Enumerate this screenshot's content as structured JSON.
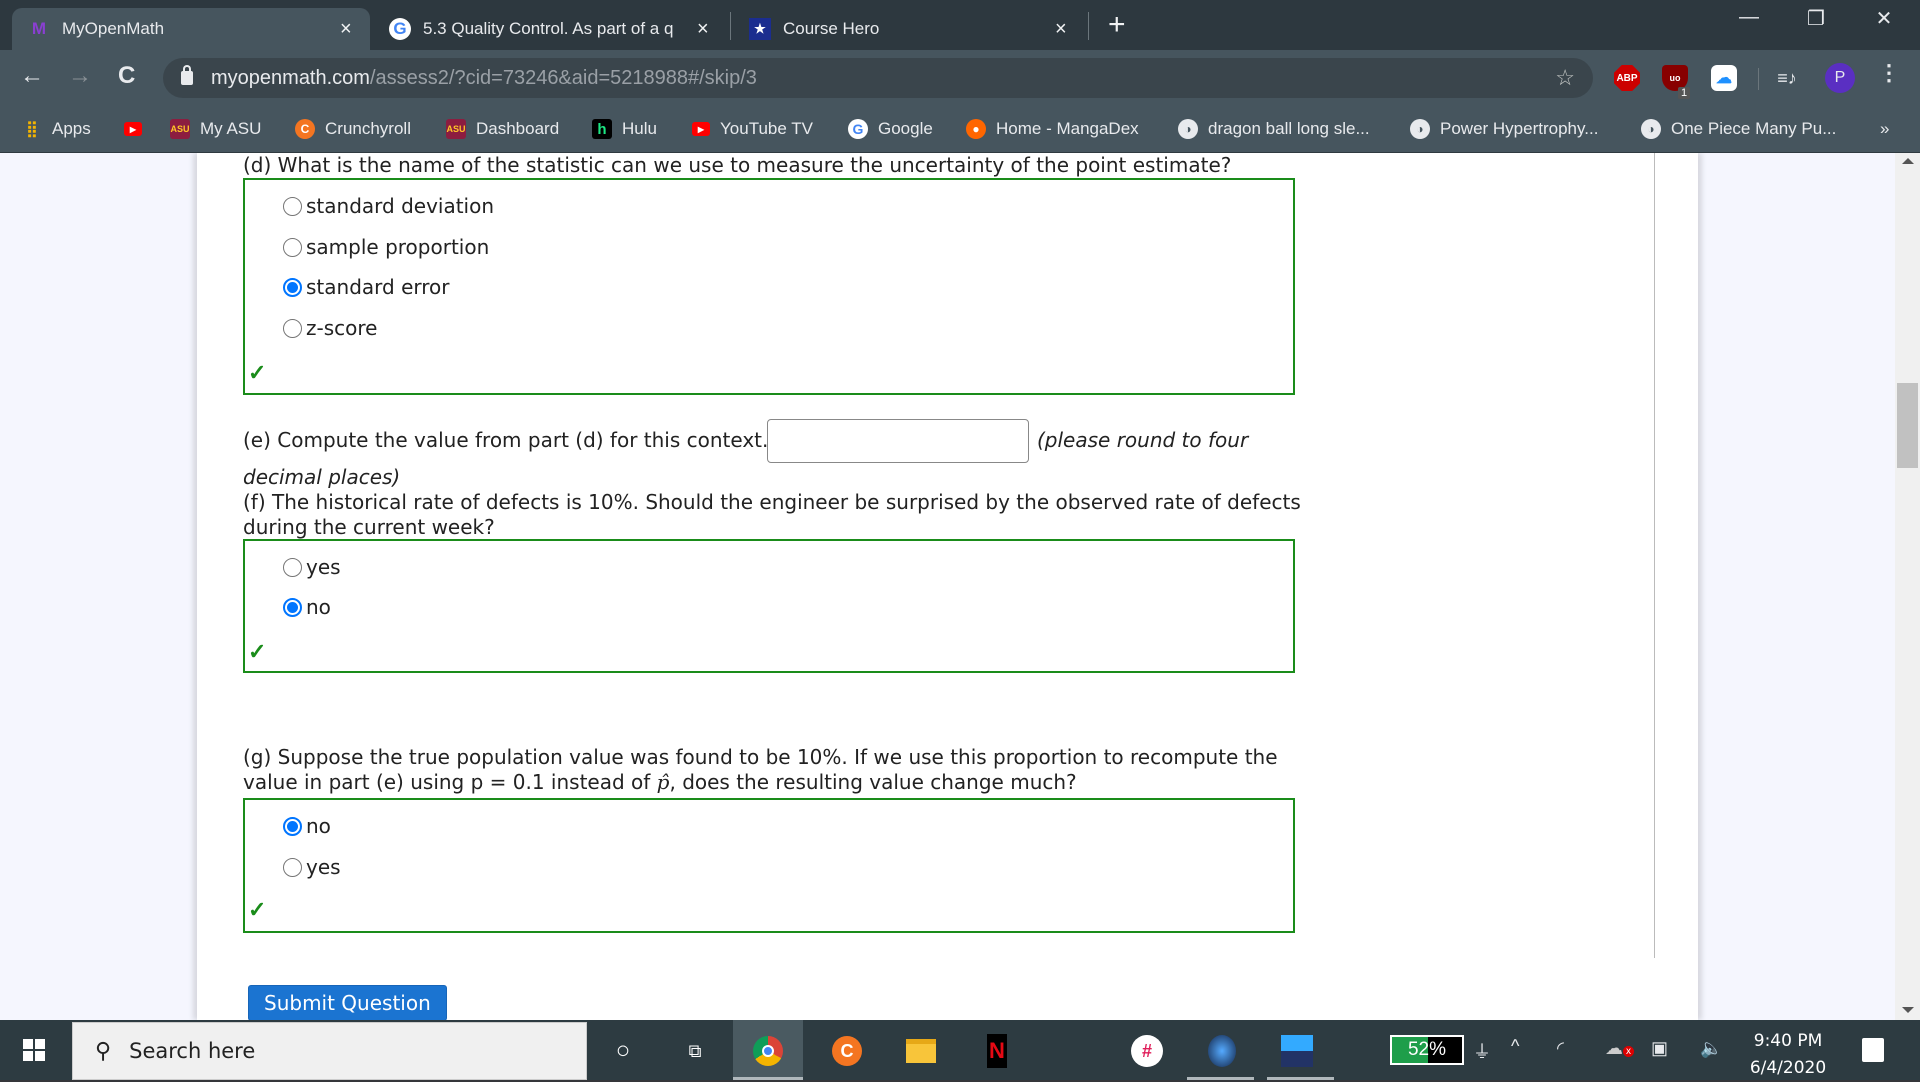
{
  "browser": {
    "tabs": [
      {
        "title": "MyOpenMath",
        "icon": "myopenmath-m-icon",
        "active": true
      },
      {
        "title": "5.3 Quality Control. As part of a q",
        "icon": "google-g-icon",
        "active": false
      },
      {
        "title": "Course Hero",
        "icon": "coursehero-star-icon",
        "active": false
      }
    ],
    "new_tab_label": "+",
    "window_controls": {
      "minimize": "—",
      "restore": "❐",
      "close": "✕"
    },
    "nav": {
      "back": "←",
      "forward": "→",
      "reload": "C"
    },
    "address": {
      "host": "myopenmath.com",
      "path": "/assess2/?cid=73246&aid=5218988#/skip/3"
    },
    "extensions": {
      "abp": "ABP",
      "ublock": "uo",
      "ublock_badge": "1",
      "cloud": "☁",
      "media": "≡♪"
    },
    "profile_initial": "P",
    "bookmarks": [
      {
        "label": "Apps",
        "icon": "apps-grid-icon"
      },
      {
        "label": "",
        "icon": "youtube-icon"
      },
      {
        "label": "My ASU",
        "icon": "asu-icon"
      },
      {
        "label": "Crunchyroll",
        "icon": "crunchyroll-icon"
      },
      {
        "label": "Dashboard",
        "icon": "asu-pitchfork-icon"
      },
      {
        "label": "Hulu",
        "icon": "hulu-icon"
      },
      {
        "label": "YouTube TV",
        "icon": "youtube-tv-icon"
      },
      {
        "label": "Google",
        "icon": "google-icon"
      },
      {
        "label": "Home - MangaDex",
        "icon": "mangadex-icon"
      },
      {
        "label": "dragon ball long sle...",
        "icon": "globe-icon"
      },
      {
        "label": "Power Hypertrophy...",
        "icon": "globe-icon"
      },
      {
        "label": "One Piece Many Pu...",
        "icon": "globe-icon"
      }
    ],
    "bookmarks_overflow": "»"
  },
  "question": {
    "d": {
      "prompt": "(d) What is the name of the statistic can we use to measure the uncertainty of the point estimate?",
      "options": [
        "standard deviation",
        "sample proportion",
        "standard error",
        "z-score"
      ],
      "selected": 2,
      "correct_mark": "✓"
    },
    "e": {
      "prompt": "(e) Compute the value from part (d) for this context.",
      "answer_value": "",
      "hint_line1": "(please round to four",
      "hint_line2": "decimal places)"
    },
    "f": {
      "prompt_line1": "(f) The historical rate of defects is 10%. Should the engineer be surprised by the observed rate of defects",
      "prompt_line2": "during the current week?",
      "options": [
        "yes",
        "no"
      ],
      "selected": 1,
      "correct_mark": "✓"
    },
    "g": {
      "prompt_line1": "(g) Suppose the true population value was found to be 10%. If we use this proportion to recompute the",
      "prompt_line2_a": "value in part (e) using p = 0.1 instead of ",
      "prompt_line2_phat": "p̂",
      "prompt_line2_b": ", does the resulting value change much?",
      "options": [
        "no",
        "yes"
      ],
      "selected": 0,
      "correct_mark": "✓"
    },
    "submit_label": "Submit Question"
  },
  "taskbar": {
    "search_placeholder": "Search here",
    "battery_percent": 52,
    "battery_label": "52%",
    "time": "9:40 PM",
    "date": "6/4/2020"
  },
  "colors": {
    "correct_border": "#1a8c1a",
    "radio_selected": "#0075ff",
    "submit_bg": "#1b74d1"
  }
}
